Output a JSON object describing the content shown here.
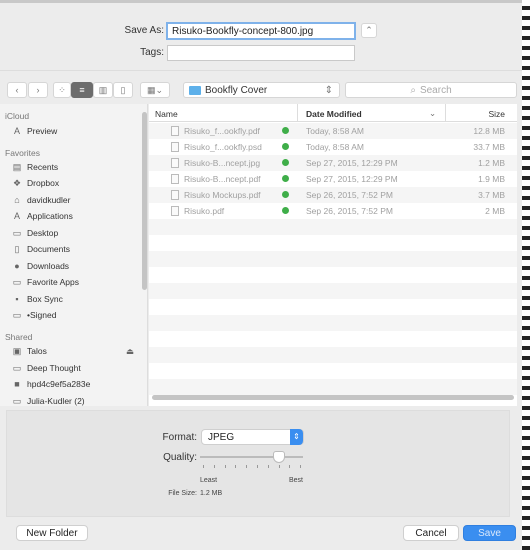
{
  "header": {
    "save_as_label": "Save As:",
    "save_as_value": "Risuko-Bookfly-concept-800.jpg",
    "tags_label": "Tags:",
    "tags_value": "",
    "expand_icon": "chevron-up-icon"
  },
  "toolbar": {
    "back_icon": "chevron-left-icon",
    "forward_icon": "chevron-right-icon",
    "view_modes": [
      "icon-view",
      "list-view",
      "column-view",
      "cover-flow-view"
    ],
    "active_view": "list-view",
    "location": "Bookfly Cover",
    "search_placeholder": "Search"
  },
  "sidebar": {
    "sections": [
      {
        "title": "iCloud",
        "items": [
          {
            "label": "Preview",
            "icon": "app-icon"
          }
        ]
      },
      {
        "title": "Favorites",
        "items": [
          {
            "label": "Recents",
            "icon": "recents-icon"
          },
          {
            "label": "Dropbox",
            "icon": "dropbox-icon"
          },
          {
            "label": "davidkudler",
            "icon": "home-icon"
          },
          {
            "label": "Applications",
            "icon": "applications-icon"
          },
          {
            "label": "Desktop",
            "icon": "desktop-icon"
          },
          {
            "label": "Documents",
            "icon": "documents-icon"
          },
          {
            "label": "Downloads",
            "icon": "downloads-icon"
          },
          {
            "label": "Favorite Apps",
            "icon": "folder-icon"
          },
          {
            "label": "Box Sync",
            "icon": "box-icon"
          },
          {
            "label": "•Signed",
            "icon": "folder-icon"
          }
        ]
      },
      {
        "title": "Shared",
        "items": [
          {
            "label": "Talos",
            "icon": "server-icon"
          },
          {
            "label": "Deep Thought",
            "icon": "display-icon"
          },
          {
            "label": "hpd4c9ef5a283e",
            "icon": "computer-icon"
          },
          {
            "label": "Julia-Kudler (2)",
            "icon": "display-icon"
          }
        ]
      }
    ]
  },
  "list": {
    "columns": [
      "Name",
      "Date Modified",
      "Size"
    ],
    "sort_column": "Date Modified",
    "rows": [
      {
        "name": "Risuko_f...ookfly.pdf",
        "date": "Today, 8:58 AM",
        "size": "12.8 MB"
      },
      {
        "name": "Risuko_f...ookfly.psd",
        "date": "Today, 8:58 AM",
        "size": "33.7 MB"
      },
      {
        "name": "Risuko-B...ncept.jpg",
        "date": "Sep 27, 2015, 12:29 PM",
        "size": "1.2 MB"
      },
      {
        "name": "Risuko-B...ncept.pdf",
        "date": "Sep 27, 2015, 12:29 PM",
        "size": "1.9 MB"
      },
      {
        "name": "Risuko Mockups.pdf",
        "date": "Sep 26, 2015, 7:52 PM",
        "size": "3.7 MB"
      },
      {
        "name": "Risuko.pdf",
        "date": "Sep 26, 2015, 7:52 PM",
        "size": "2 MB"
      }
    ]
  },
  "options": {
    "format_label": "Format:",
    "format_value": "JPEG",
    "quality_label": "Quality:",
    "quality_level": 0.77,
    "least_label": "Least",
    "best_label": "Best",
    "filesize_label": "File Size:",
    "filesize_value": "1.2 MB"
  },
  "footer": {
    "new_folder": "New Folder",
    "cancel": "Cancel",
    "save": "Save"
  },
  "colors": {
    "accent": "#3a8ef0",
    "synced": "#3fae49"
  }
}
